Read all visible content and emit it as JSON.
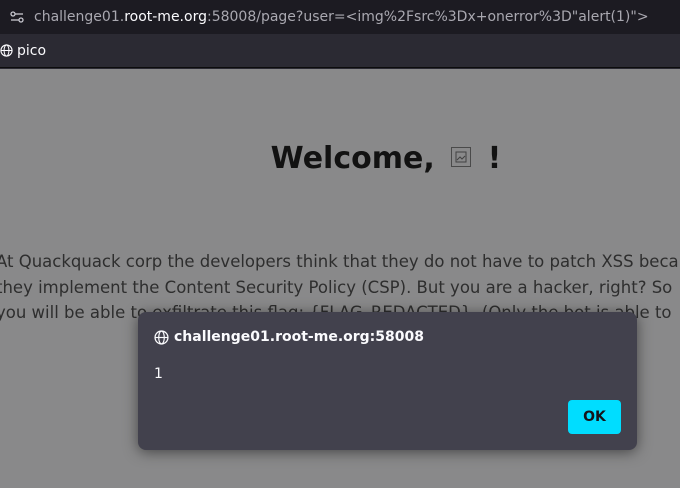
{
  "urlbar": {
    "url_prefix": "challenge01.",
    "url_domain": "root-me.org",
    "url_suffix": ":58008/page?user=<img%2Fsrc%3Dx+onerror%3D\"alert(1)\">"
  },
  "bookmarks": [
    {
      "label": "pico",
      "icon": "globe-icon"
    }
  ],
  "page": {
    "welcome_prefix": "Welcome,",
    "welcome_suffix": "!",
    "paragraph_lines": [
      "At Quackquack corp the developers think that they do not have to patch XSS because",
      "they implement the Content Security Policy (CSP). But you are a hacker, right? So",
      "you will be able to exfiltrate this flag: {FLAG_REDACTED}. (Only the bot is able to"
    ]
  },
  "dialog": {
    "origin": "challenge01.root-me.org:58008",
    "message": "1",
    "ok_label": "OK"
  },
  "colors": {
    "accent": "#00ddff",
    "dialog_bg": "#42414d",
    "toolbar_bg": "#1c1b22"
  }
}
